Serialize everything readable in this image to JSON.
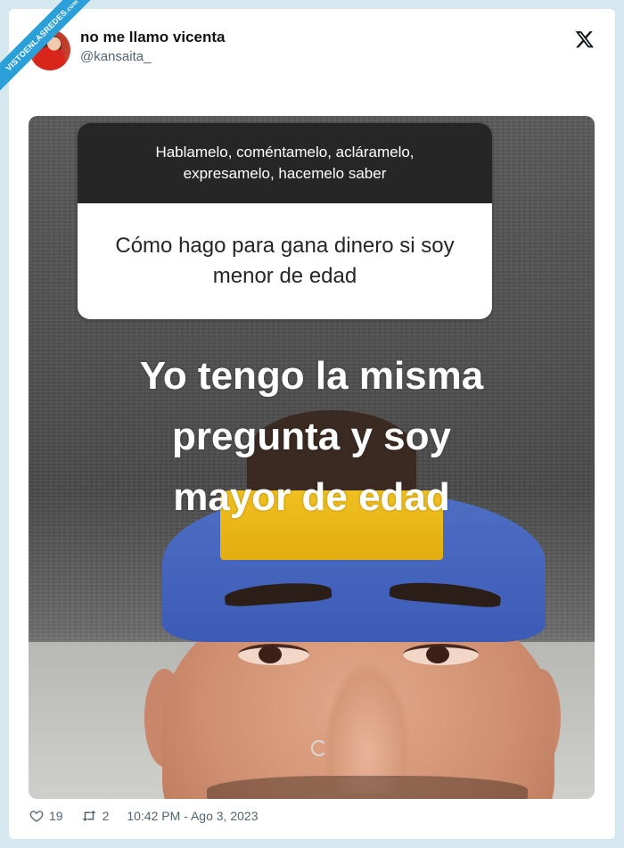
{
  "watermark": {
    "text": "VISTOENLASREDES",
    "subtext": ".com"
  },
  "tweet": {
    "author_name": "no me llamo vicenta",
    "author_handle": "@kansaita_",
    "platform_icon": "x-logo-icon"
  },
  "media": {
    "question_prompt": "Hablamelo, coméntamelo, acláramelo, expresamelo, hacemelo saber",
    "question_text": "Cómo hago para gana dinero si soy menor de edad",
    "caption_lines": [
      "Yo tengo la misma",
      "pregunta y soy",
      "mayor de edad"
    ]
  },
  "stats": {
    "likes": "19",
    "retweets": "2",
    "timestamp": "10:42 PM - Ago 3, 2023"
  }
}
